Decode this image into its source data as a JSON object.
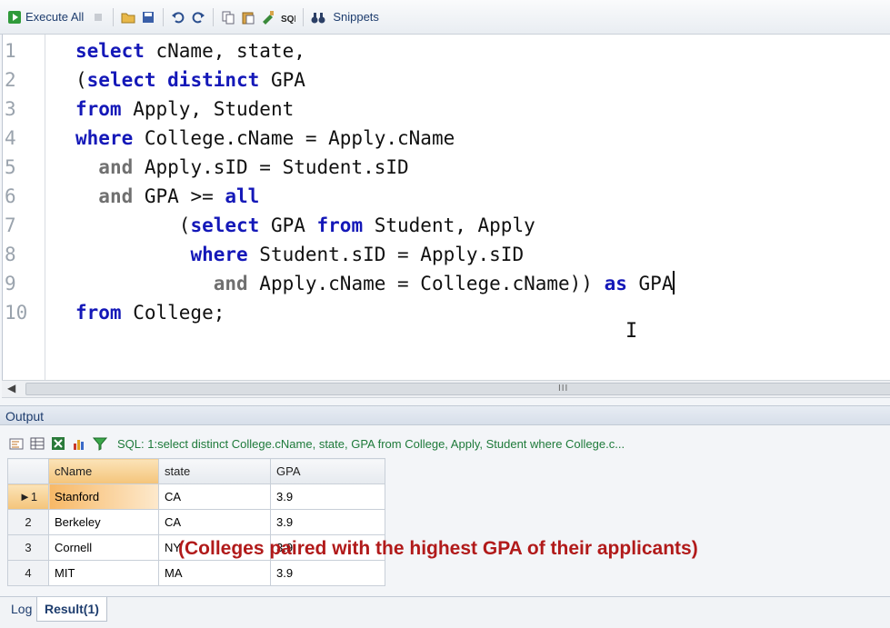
{
  "toolbar": {
    "execute_all": "Execute All",
    "snippets": "Snippets"
  },
  "editor": {
    "lines": [
      {
        "n": "1",
        "tokens": [
          {
            "t": "select",
            "c": "kw"
          },
          {
            "t": " cName, state,",
            "c": ""
          }
        ]
      },
      {
        "n": "2",
        "tokens": [
          {
            "t": "(",
            "c": ""
          },
          {
            "t": "select distinct",
            "c": "kw"
          },
          {
            "t": " GPA",
            "c": ""
          }
        ]
      },
      {
        "n": "3",
        "tokens": [
          {
            "t": "from",
            "c": "kw"
          },
          {
            "t": " Apply, Student",
            "c": ""
          }
        ]
      },
      {
        "n": "4",
        "tokens": [
          {
            "t": "where",
            "c": "kw"
          },
          {
            "t": " College.cName = Apply.cName",
            "c": ""
          }
        ]
      },
      {
        "n": "5",
        "tokens": [
          {
            "t": "  ",
            "c": ""
          },
          {
            "t": "and",
            "c": "gr"
          },
          {
            "t": " Apply.sID = Student.sID",
            "c": ""
          }
        ]
      },
      {
        "n": "6",
        "tokens": [
          {
            "t": "  ",
            "c": ""
          },
          {
            "t": "and",
            "c": "gr"
          },
          {
            "t": " GPA >= ",
            "c": ""
          },
          {
            "t": "all",
            "c": "kw"
          }
        ]
      },
      {
        "n": "7",
        "tokens": [
          {
            "t": "         (",
            "c": ""
          },
          {
            "t": "select",
            "c": "kw"
          },
          {
            "t": " GPA ",
            "c": ""
          },
          {
            "t": "from",
            "c": "kw"
          },
          {
            "t": " Student, Apply",
            "c": ""
          }
        ]
      },
      {
        "n": "8",
        "tokens": [
          {
            "t": "          ",
            "c": ""
          },
          {
            "t": "where",
            "c": "kw"
          },
          {
            "t": " Student.sID = Apply.sID",
            "c": ""
          }
        ]
      },
      {
        "n": "9",
        "tokens": [
          {
            "t": "            ",
            "c": ""
          },
          {
            "t": "and",
            "c": "gr"
          },
          {
            "t": " Apply.cName = College.cName)) ",
            "c": ""
          },
          {
            "t": "as",
            "c": "kw"
          },
          {
            "t": " GPA",
            "c": ""
          }
        ]
      },
      {
        "n": "10",
        "tokens": [
          {
            "t": "from",
            "c": "kw"
          },
          {
            "t": " College;",
            "c": ""
          }
        ]
      }
    ]
  },
  "output": {
    "title": "Output",
    "sql_summary": "SQL: 1:select distinct College.cName, state, GPA  from College, Apply, Student  where College.c..."
  },
  "result_table": {
    "columns": [
      "cName",
      "state",
      "GPA"
    ],
    "rows": [
      {
        "num": "1",
        "cName": "Stanford",
        "state": "CA",
        "GPA": "3.9"
      },
      {
        "num": "2",
        "cName": "Berkeley",
        "state": "CA",
        "GPA": "3.9"
      },
      {
        "num": "3",
        "cName": "Cornell",
        "state": "NY",
        "GPA": "3.9"
      },
      {
        "num": "4",
        "cName": "MIT",
        "state": "MA",
        "GPA": "3.9"
      }
    ]
  },
  "annotation": "(Colleges paired with the highest GPA of their applicants)",
  "tabs": {
    "log": "Log",
    "result": "Result(1)"
  },
  "scrollbar": {
    "grip": "III"
  }
}
